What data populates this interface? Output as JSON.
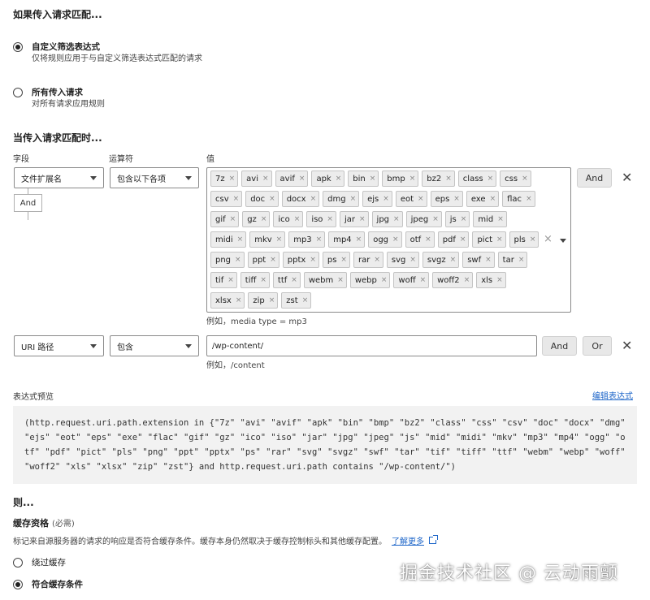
{
  "if_section": {
    "title": "如果传入请求匹配...",
    "options": [
      {
        "label": "自定义筛选表达式",
        "desc": "仅将规则应用于与自定义筛选表达式匹配的请求",
        "checked": true
      },
      {
        "label": "所有传入请求",
        "desc": "对所有请求应用规则",
        "checked": false
      }
    ]
  },
  "when_section": {
    "title": "当传入请求匹配时...",
    "columns": {
      "field": "字段",
      "operator": "运算符",
      "value": "值"
    }
  },
  "rule1": {
    "field": "文件扩展名",
    "operator": "包含以下各项",
    "tags": [
      "7z",
      "avi",
      "avif",
      "apk",
      "bin",
      "bmp",
      "bz2",
      "class",
      "css",
      "csv",
      "doc",
      "docx",
      "dmg",
      "ejs",
      "eot",
      "eps",
      "exe",
      "flac",
      "gif",
      "gz",
      "ico",
      "iso",
      "jar",
      "jpg",
      "jpeg",
      "js",
      "mid",
      "midi",
      "mkv",
      "mp3",
      "mp4",
      "ogg",
      "otf",
      "pdf",
      "pict",
      "pls",
      "png",
      "ppt",
      "pptx",
      "ps",
      "rar",
      "svg",
      "svgz",
      "swf",
      "tar",
      "tif",
      "tiff",
      "ttf",
      "webm",
      "webp",
      "woff",
      "woff2",
      "xls",
      "xlsx",
      "zip",
      "zst"
    ],
    "hint": "例如，media type = mp3",
    "and_label": "And",
    "and_connector": "And"
  },
  "rule2": {
    "field": "URI 路径",
    "operator": "包含",
    "value": "/wp-content/",
    "hint": "例如，/content",
    "and_label": "And",
    "or_label": "Or"
  },
  "preview": {
    "label": "表达式预览",
    "edit_link": "编辑表达式",
    "expression": "(http.request.uri.path.extension in {\"7z\" \"avi\" \"avif\" \"apk\" \"bin\" \"bmp\" \"bz2\" \"class\" \"css\" \"csv\" \"doc\" \"docx\" \"dmg\" \"ejs\" \"eot\" \"eps\" \"exe\" \"flac\" \"gif\" \"gz\" \"ico\" \"iso\" \"jar\" \"jpg\" \"jpeg\" \"js\" \"mid\" \"midi\" \"mkv\" \"mp3\" \"mp4\" \"ogg\" \"otf\" \"pdf\" \"pict\" \"pls\" \"png\" \"ppt\" \"pptx\" \"ps\" \"rar\" \"svg\" \"svgz\" \"swf\" \"tar\" \"tif\" \"tiff\" \"ttf\" \"webm\" \"webp\" \"woff\" \"woff2\" \"xls\" \"xlsx\" \"zip\" \"zst\"} and http.request.uri.path contains \"/wp-content/\")"
  },
  "then_section": {
    "title": "则...",
    "cache_label": "缓存资格",
    "cache_required": "(必需)",
    "cache_desc": "标记来自源服务器的请求的响应是否符合缓存条件。缓存本身仍然取决于缓存控制标头和其他缓存配置。",
    "learn_more": "了解更多",
    "options": [
      {
        "label": "绕过缓存",
        "checked": false
      },
      {
        "label": "符合缓存条件",
        "checked": true
      }
    ]
  },
  "watermark": "掘金技术社区 @ 云动雨颤"
}
